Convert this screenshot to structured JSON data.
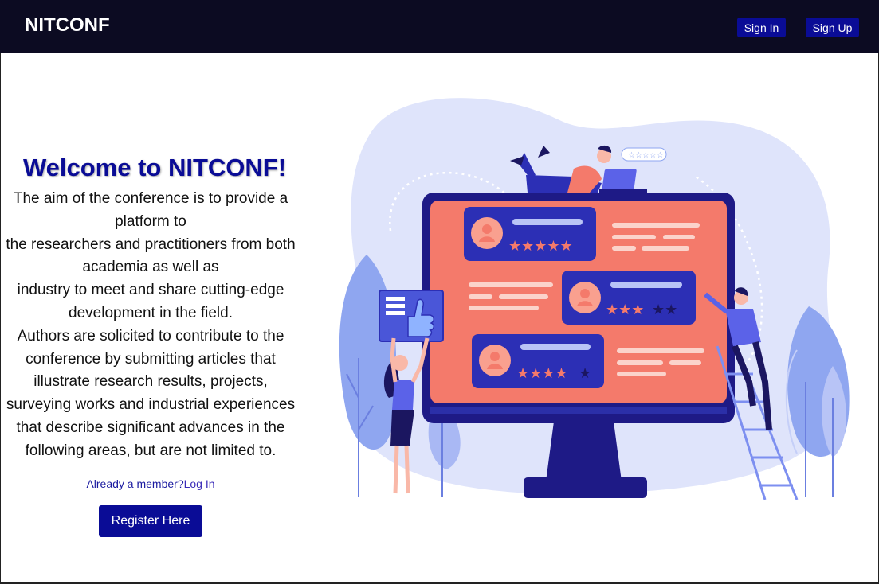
{
  "navbar": {
    "brand": "NITCONF",
    "signin_label": "Sign In",
    "signup_label": "Sign Up"
  },
  "hero": {
    "title": "Welcome to NITCONF!",
    "description_lines": [
      "The aim of the conference is to provide a platform to",
      "the researchers and practitioners from both academia as well as",
      "industry to meet and share cutting-edge development in the field.",
      "Authors are solicited to contribute to the conference by submitting articles that illustrate research results, projects, surveying works and industrial experiences that describe significant advances in the following areas, but are not limited to."
    ],
    "member_prompt": "Already a member?",
    "login_link": "Log In",
    "register_label": "Register Here"
  },
  "colors": {
    "navbar_bg": "#0c0b22",
    "accent": "#0a0c96",
    "screen": "#f47a6b",
    "blob": "#dde3fb"
  },
  "illustration": {
    "icons": [
      "monitor-icon",
      "review-card-icon",
      "star-icon",
      "thumbs-up-icon",
      "person-icon",
      "ladder-icon",
      "plant-icon"
    ]
  }
}
